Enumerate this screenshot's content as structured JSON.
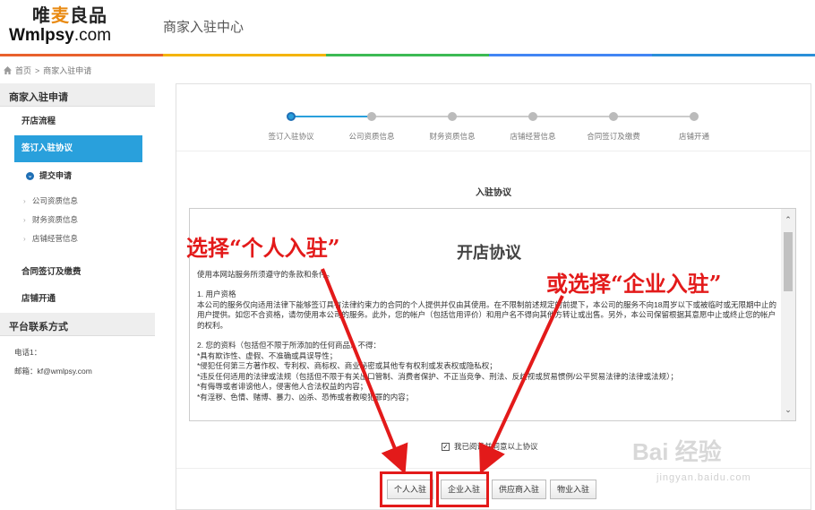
{
  "header": {
    "logo_cn_1": "唯",
    "logo_cn_2": "麦",
    "logo_cn_3": "良品",
    "logo_en_bold": "Wmlpsy",
    "logo_en_rest": ".com",
    "title": "商家入驻中心",
    "rainbow_colors": [
      "#e8612c",
      "#f4b400",
      "#3cba54",
      "#4285f4",
      "#2a8fd8"
    ]
  },
  "breadcrumb": {
    "home": "首页",
    "separator": ">",
    "current": "商家入驻申请"
  },
  "sidebar": {
    "section1": "商家入驻申请",
    "items": {
      "open_process": "开店流程",
      "sign_agreement": "签订入驻协议",
      "submit_application": "提交申请",
      "company_info": "公司资质信息",
      "finance_info": "财务资质信息",
      "shop_info": "店铺经营信息",
      "contract_fee": "合同签订及缴费",
      "shop_open": "店铺开通"
    },
    "section2": "平台联系方式",
    "phone": "电话1：",
    "email": "邮箱：kf@wmlpsy.com"
  },
  "steps": [
    {
      "label": "签订入驻协议",
      "done": true
    },
    {
      "label": "公司资质信息",
      "done": false
    },
    {
      "label": "财务资质信息",
      "done": false
    },
    {
      "label": "店铺经营信息",
      "done": false
    },
    {
      "label": "合同签订及缴费",
      "done": false
    },
    {
      "label": "店铺开通",
      "done": false
    }
  ],
  "agreement": {
    "section_title": "入驻协议",
    "doc_title": "开店协议",
    "p0": "使用本网站服务所须遵守的条款和条件。",
    "p1_title": "1. 用户资格",
    "p1_body": "本公司的服务仅向适用法律下能够签订具有法律约束力的合同的个人提供并仅由其使用。在不限制前述规定的前提下，本公司的服务不向18周岁以下或被临时或无限期中止的用户提供。如您不合资格，请勿使用本公司的服务。此外，您的帐户（包括信用评价）和用户名不得向其他方转让或出售。另外，本公司保留根据其意愿中止或终止您的帐户的权利。",
    "p2_title": "2. 您的资料（包括但不限于所添加的任何商品）不得：",
    "p2_l1": "*具有欺诈性、虚假、不准确或具误导性；",
    "p2_l2": "*侵犯任何第三方著作权、专利权、商标权、商业秘密或其他专有权利或发表权或隐私权；",
    "p2_l3": "*违反任何适用的法律或法规（包括但不限于有关出口管制、消费者保护、不正当竞争、刑法、反歧视或贸易惯例/公平贸易法律的法律或法规）；",
    "p2_l4": "*有侮辱或者诽谤他人，侵害他人合法权益的内容；",
    "p2_l5": "*有淫秽、色情、赌博、暴力、凶杀、恐怖或者教唆犯罪的内容；",
    "scroll_up": "⌃",
    "scroll_down": "⌄"
  },
  "agree_checkbox": {
    "checked": true,
    "mark": "✓",
    "label": "我已阅读并同意以上协议"
  },
  "buttons": {
    "personal": "个人入驻",
    "enterprise": "企业入驻",
    "supplier": "供应商入驻",
    "property": "物业入驻"
  },
  "annotations": {
    "left": "选择“个人入驻”",
    "right": "或选择“企业入驻”",
    "color": "#e31a1a"
  },
  "watermark": {
    "main": "Bai 经验",
    "url": "jingyan.baidu.com"
  }
}
